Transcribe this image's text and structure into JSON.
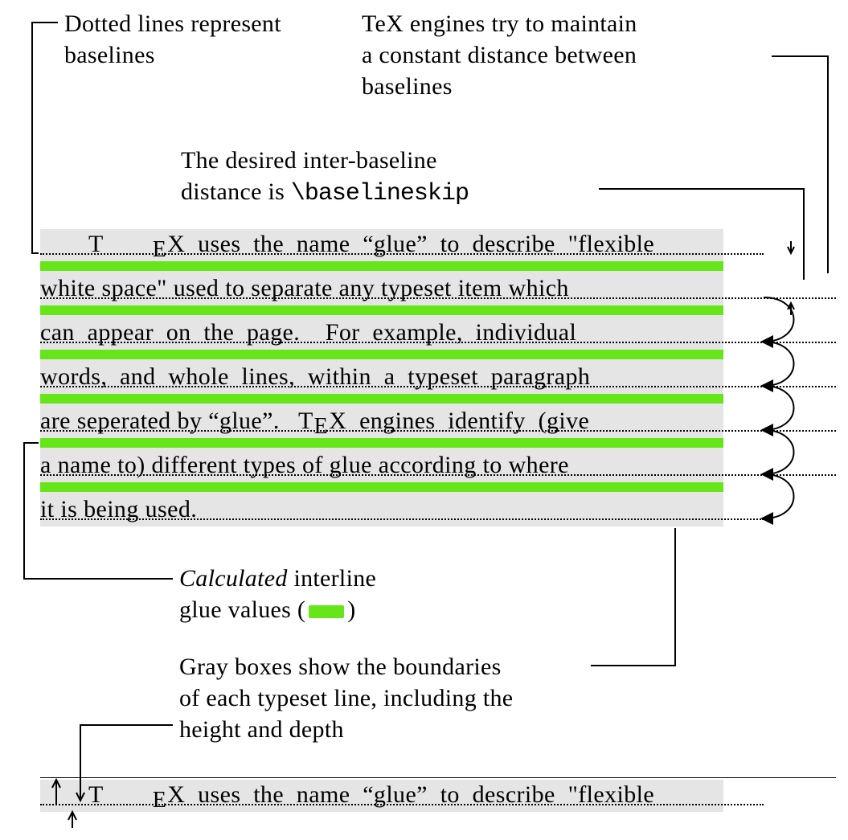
{
  "labels": {
    "dotted": "Dotted lines represent\nbaselines",
    "engines": "TeX engines try to maintain\na constant distance between\nbaselines",
    "desired_a": "The desired inter-baseline",
    "desired_b": "distance is ",
    "desired_cmd": "\\baselineskip",
    "calc_a": "Calculated",
    "calc_b": " interline\nglue values (",
    "calc_c": ")",
    "gray": "Gray boxes show the boundaries\nof each typeset line, including the\nheight and depth"
  },
  "para": [
    "T_E_X  uses  the  name  \"glue\"  to  describe  \"flexible",
    "white space\" used to separate any typeset item which",
    "can  appear  on  the  page.    For  example,  individual",
    "words,  and  whole  lines,  within  a  typeset  paragraph",
    "are seperated by \"glue\".   T_E_X  engines  identify  (give",
    "a name to) different types of glue according to where",
    "it is being used."
  ],
  "bottomline": "T_E_X  uses  the  name  \"glue\"  to  describe  \"flexible"
}
